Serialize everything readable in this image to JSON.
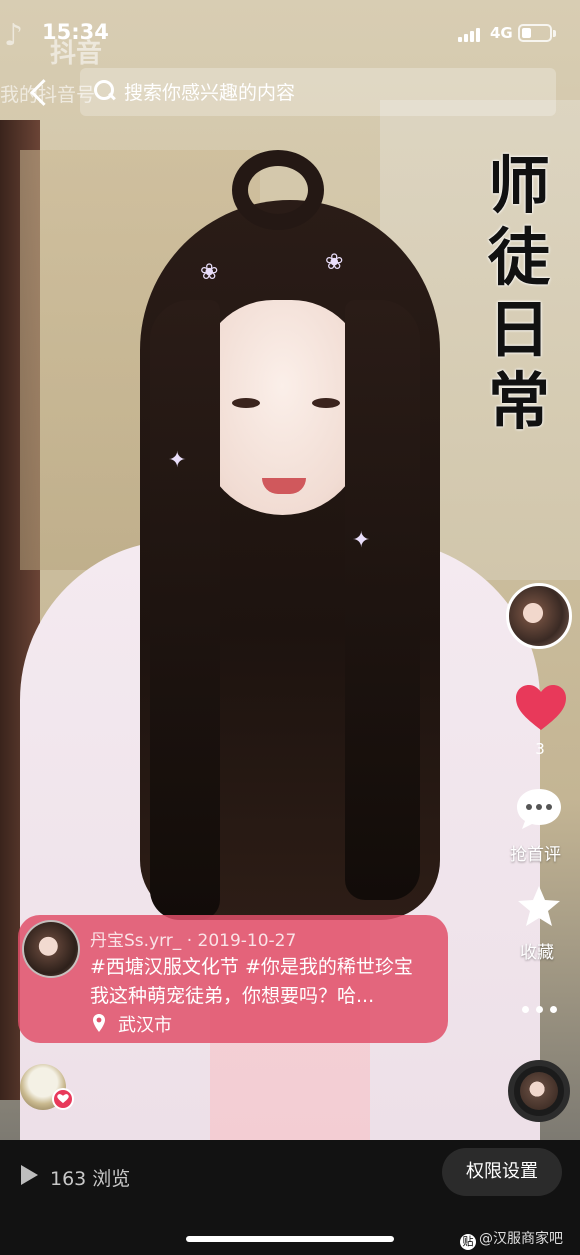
{
  "status_bar": {
    "time": "15:34",
    "network": "4G"
  },
  "watermark": {
    "app_name": "抖音"
  },
  "search": {
    "ghost_text": "我的抖音号",
    "placeholder": "搜索你感兴趣的内容"
  },
  "video": {
    "title_chars": [
      "师",
      "徒",
      "日",
      "常"
    ]
  },
  "actions": {
    "like_count": "3",
    "comment_label": "抢首评",
    "favorite_label": "收藏"
  },
  "post": {
    "username": "丹宝Ss.yrr_",
    "separator": "·",
    "date": "2019-10-27",
    "caption_line1": "#西塘汉服文化节 #你是我的稀世珍宝",
    "caption_line2": "我这种萌宠徒弟，你想要吗？哈...",
    "location": "武汉市"
  },
  "bottom": {
    "views_label": "163 浏览",
    "permission_button": "权限设置",
    "credit_text": "@汉服商家吧",
    "credit_mark": "贴"
  },
  "colors": {
    "like_red": "#e8395a",
    "card_pink": "#e0506a",
    "bottom_bg": "#121212"
  }
}
